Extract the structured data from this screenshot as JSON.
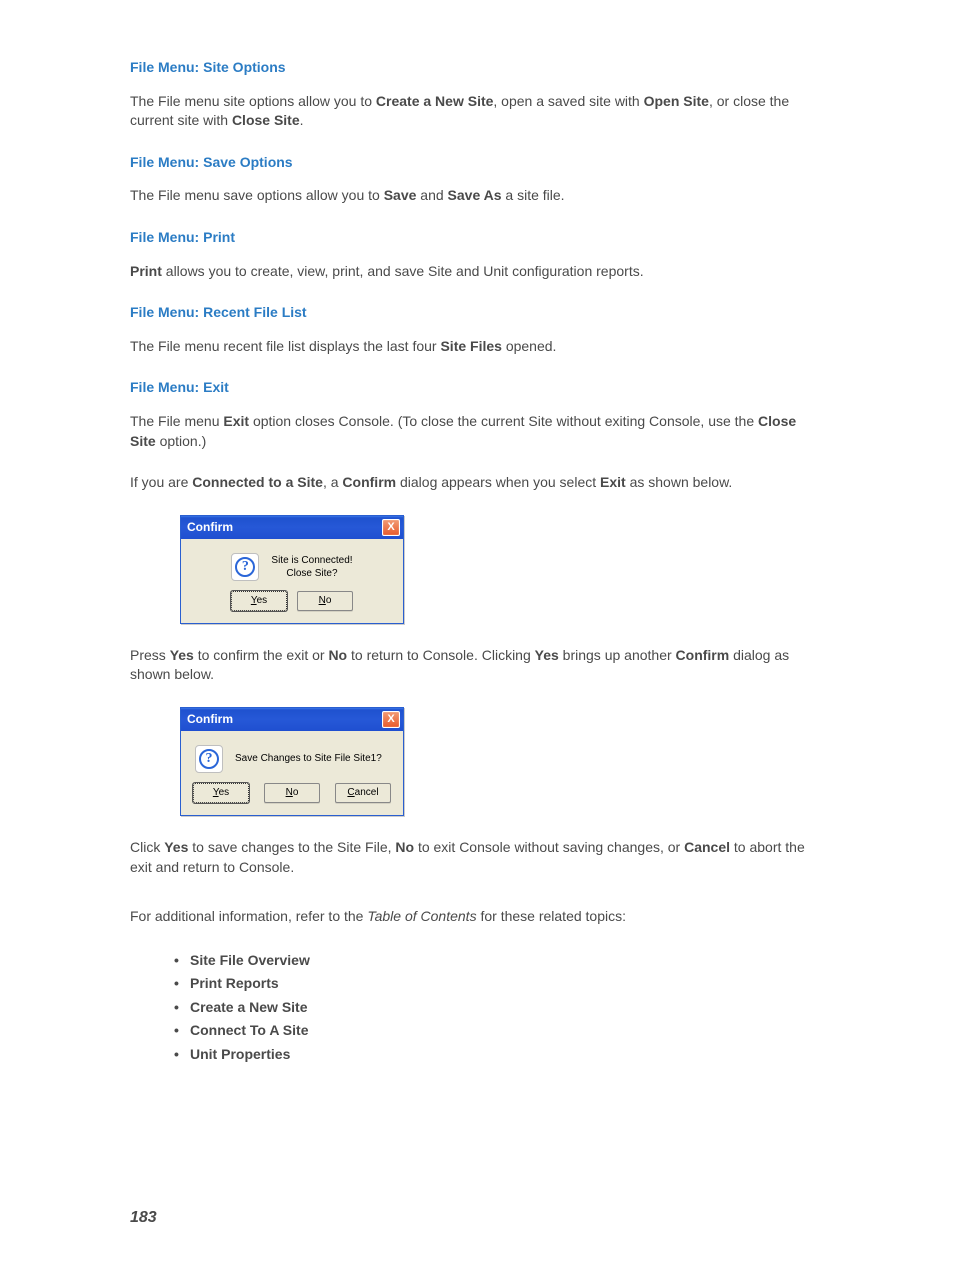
{
  "sections": {
    "site": {
      "heading": "File Menu: Site Options",
      "p1_a": "The File menu site options allow you to ",
      "p1_b1": "Create a New Site",
      "p1_c": ", open a saved site with ",
      "p1_b2": "Open Site",
      "p1_d": ", or close the current site with ",
      "p1_b3": "Close Site",
      "p1_e": "."
    },
    "save": {
      "heading": "File Menu: Save Options",
      "p1_a": "The File menu save options allow you to ",
      "p1_b1": "Save",
      "p1_c": " and ",
      "p1_b2": "Save As",
      "p1_d": " a site file."
    },
    "print": {
      "heading": "File Menu: Print",
      "p1_b1": "Print",
      "p1_a": " allows you to create, view, print, and save Site and Unit configuration reports."
    },
    "recent": {
      "heading": "File Menu: Recent File List",
      "p1_a": "The File menu recent file list displays the last four ",
      "p1_b1": "Site Files",
      "p1_c": " opened."
    },
    "exit": {
      "heading": "File Menu: Exit",
      "p1_a": "The File menu ",
      "p1_b1": "Exit",
      "p1_b": " option closes Console. (To close the current Site without exiting Console, use the ",
      "p1_b2": "Close Site",
      "p1_c": " option.)",
      "p2_a": "If you are ",
      "p2_b1": "Connected to a Site",
      "p2_b": ", a ",
      "p2_b2": "Confirm",
      "p2_c": " dialog appears when you select ",
      "p2_b3": "Exit",
      "p2_d": " as shown below."
    },
    "after1": {
      "p_a": "Press ",
      "p_b1": "Yes",
      "p_b": " to confirm the exit or ",
      "p_b2": "No",
      "p_c": " to return to Console. Clicking ",
      "p_b3": "Yes",
      "p_d": " brings up another ",
      "p_b4": "Confirm",
      "p_e": " dialog as shown below."
    },
    "after2": {
      "p_a": "Click ",
      "p_b1": "Yes",
      "p_b": " to save changes to the Site File, ",
      "p_b2": "No",
      "p_c": " to exit Console without saving changes, or ",
      "p_b3": "Cancel",
      "p_d": " to abort the exit and return to Console."
    },
    "addl": {
      "p_a": "For additional information, refer to the ",
      "p_i": "Table of Contents",
      "p_b": " for these related topics:"
    }
  },
  "dialog1": {
    "title": "Confirm",
    "close_glyph": "X",
    "q": "?",
    "msg1": "Site is Connected!",
    "msg2": "Close Site?",
    "yes_pre": "",
    "yes_ul": "Y",
    "yes_post": "es",
    "no_pre": "",
    "no_ul": "N",
    "no_post": "o"
  },
  "dialog2": {
    "title": "Confirm",
    "close_glyph": "X",
    "q": "?",
    "msg": "Save Changes to Site File Site1?",
    "yes_pre": "",
    "yes_ul": "Y",
    "yes_post": "es",
    "no_pre": "",
    "no_ul": "N",
    "no_post": "o",
    "cancel_ul": "C",
    "cancel_post": "ancel"
  },
  "topics": {
    "t1": "Site File Overview",
    "t2": "Print Reports",
    "t3": "Create a New Site",
    "t4": "Connect To A Site",
    "t5": "Unit Properties"
  },
  "page_number": "183"
}
